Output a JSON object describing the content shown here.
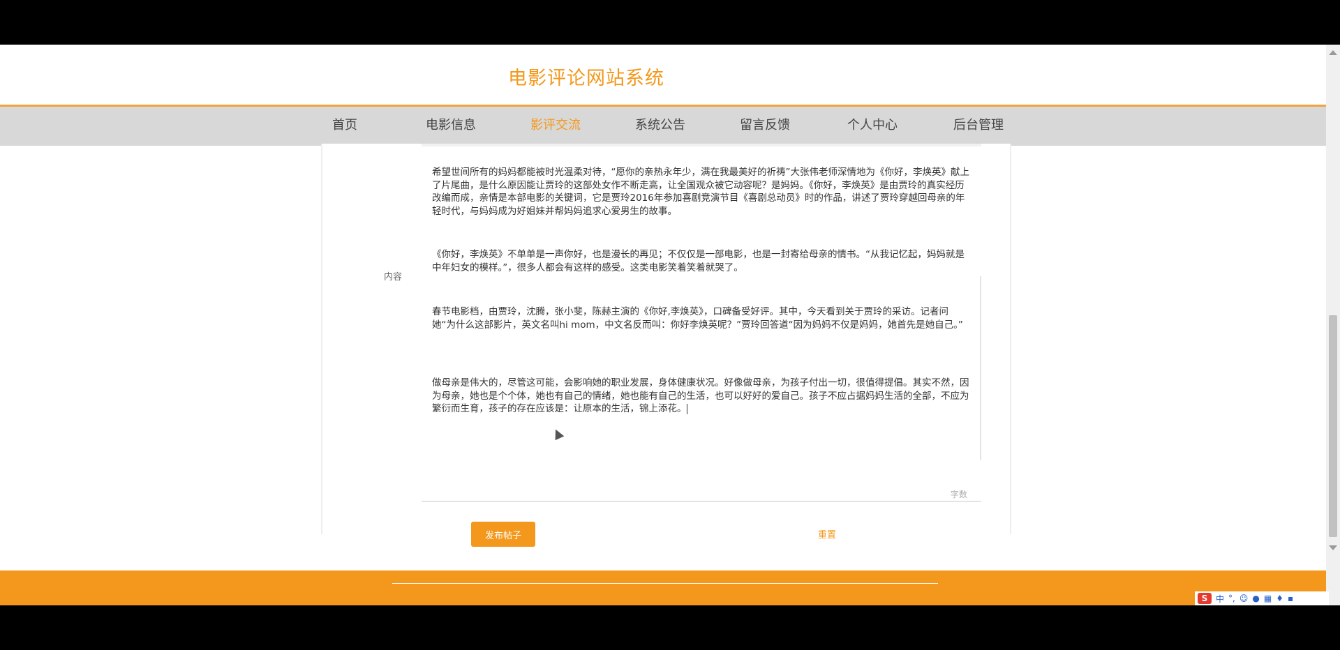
{
  "site": {
    "title": "电影评论网站系统"
  },
  "nav": {
    "items": [
      "首页",
      "电影信息",
      "影评交流",
      "系统公告",
      "留言反馈",
      "个人中心",
      "后台管理"
    ],
    "active_index": 2
  },
  "form": {
    "content_label": "内容",
    "paragraphs": [
      "希望世间所有的妈妈都能被时光温柔对待，“愿你的亲热永年少，满在我最美好的祈祷”大张伟老师深情地为《你好，李焕英》献上了片尾曲，是什么原因能让贾玲的这部处女作不断走高，让全国观众被它动容呢？是妈妈。《你好，李焕英》是由贾玲的真实经历改编而成，亲情是本部电影的关键词，它是贾玲2016年参加喜剧竞演节目《喜剧总动员》时的作品，讲述了贾玲穿越回母亲的年轻时代，与妈妈成为好姐妹并帮妈妈追求心爱男生的故事。",
      "《你好，李焕英》不单单是一声你好，也是漫长的再见；不仅仅是一部电影，也是一封寄给母亲的情书。“从我记忆起，妈妈就是中年妇女的模样。”，很多人都会有这样的感受。这类电影笑着笑着就哭了。",
      "春节电影档，由贾玲，沈腾，张小斐，陈赫主演的《你好,李焕英》，口碑备受好评。其中，今天看到关于贾玲的采访。记者问她“为什么这部影片，英文名叫hi mom，中文名反而叫：你好李焕英呢？”贾玲回答道“因为妈妈不仅是妈妈，她首先是她自己。”",
      "做母亲是伟大的，尽管这可能，会影响她的职业发展，身体健康状况。好像做母亲，为孩子付出一切，很值得提倡。其实不然，因为母亲，她也是个个体，她也有自己的情绪，她也能有自己的生活，也可以好好的爱自己。孩子不应占据妈妈生活的全部，不应为繁衍而生育，孩子的存在应该是：让原本的生活，锦上添花。"
    ],
    "word_count": "字数",
    "submit_label": "发布帖子",
    "reset_label": "重置"
  },
  "colors": {
    "accent": "#f3981c",
    "nav_bg": "#d8d8d8"
  }
}
